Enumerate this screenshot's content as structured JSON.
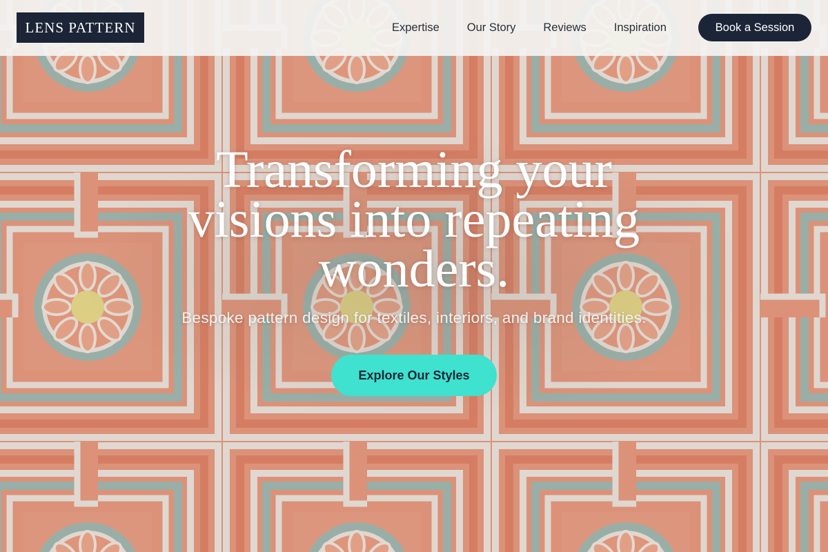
{
  "header": {
    "logo": "LENS PATTERN",
    "nav": [
      "Expertise",
      "Our Story",
      "Reviews",
      "Inspiration"
    ],
    "cta_label": "Book a Session"
  },
  "hero": {
    "title": "Transforming your visions into repeating wonders.",
    "subtitle": "Bespoke pattern design for textiles, interiors, and brand identities.",
    "button_label": "Explore Our Styles"
  },
  "colors": {
    "navy": "#1b2537",
    "teal": "#3fe1cf",
    "coral": "#e98c6d",
    "sage": "#8fb3ac",
    "cream": "#f3f3f1",
    "yellow": "#ece07a"
  }
}
